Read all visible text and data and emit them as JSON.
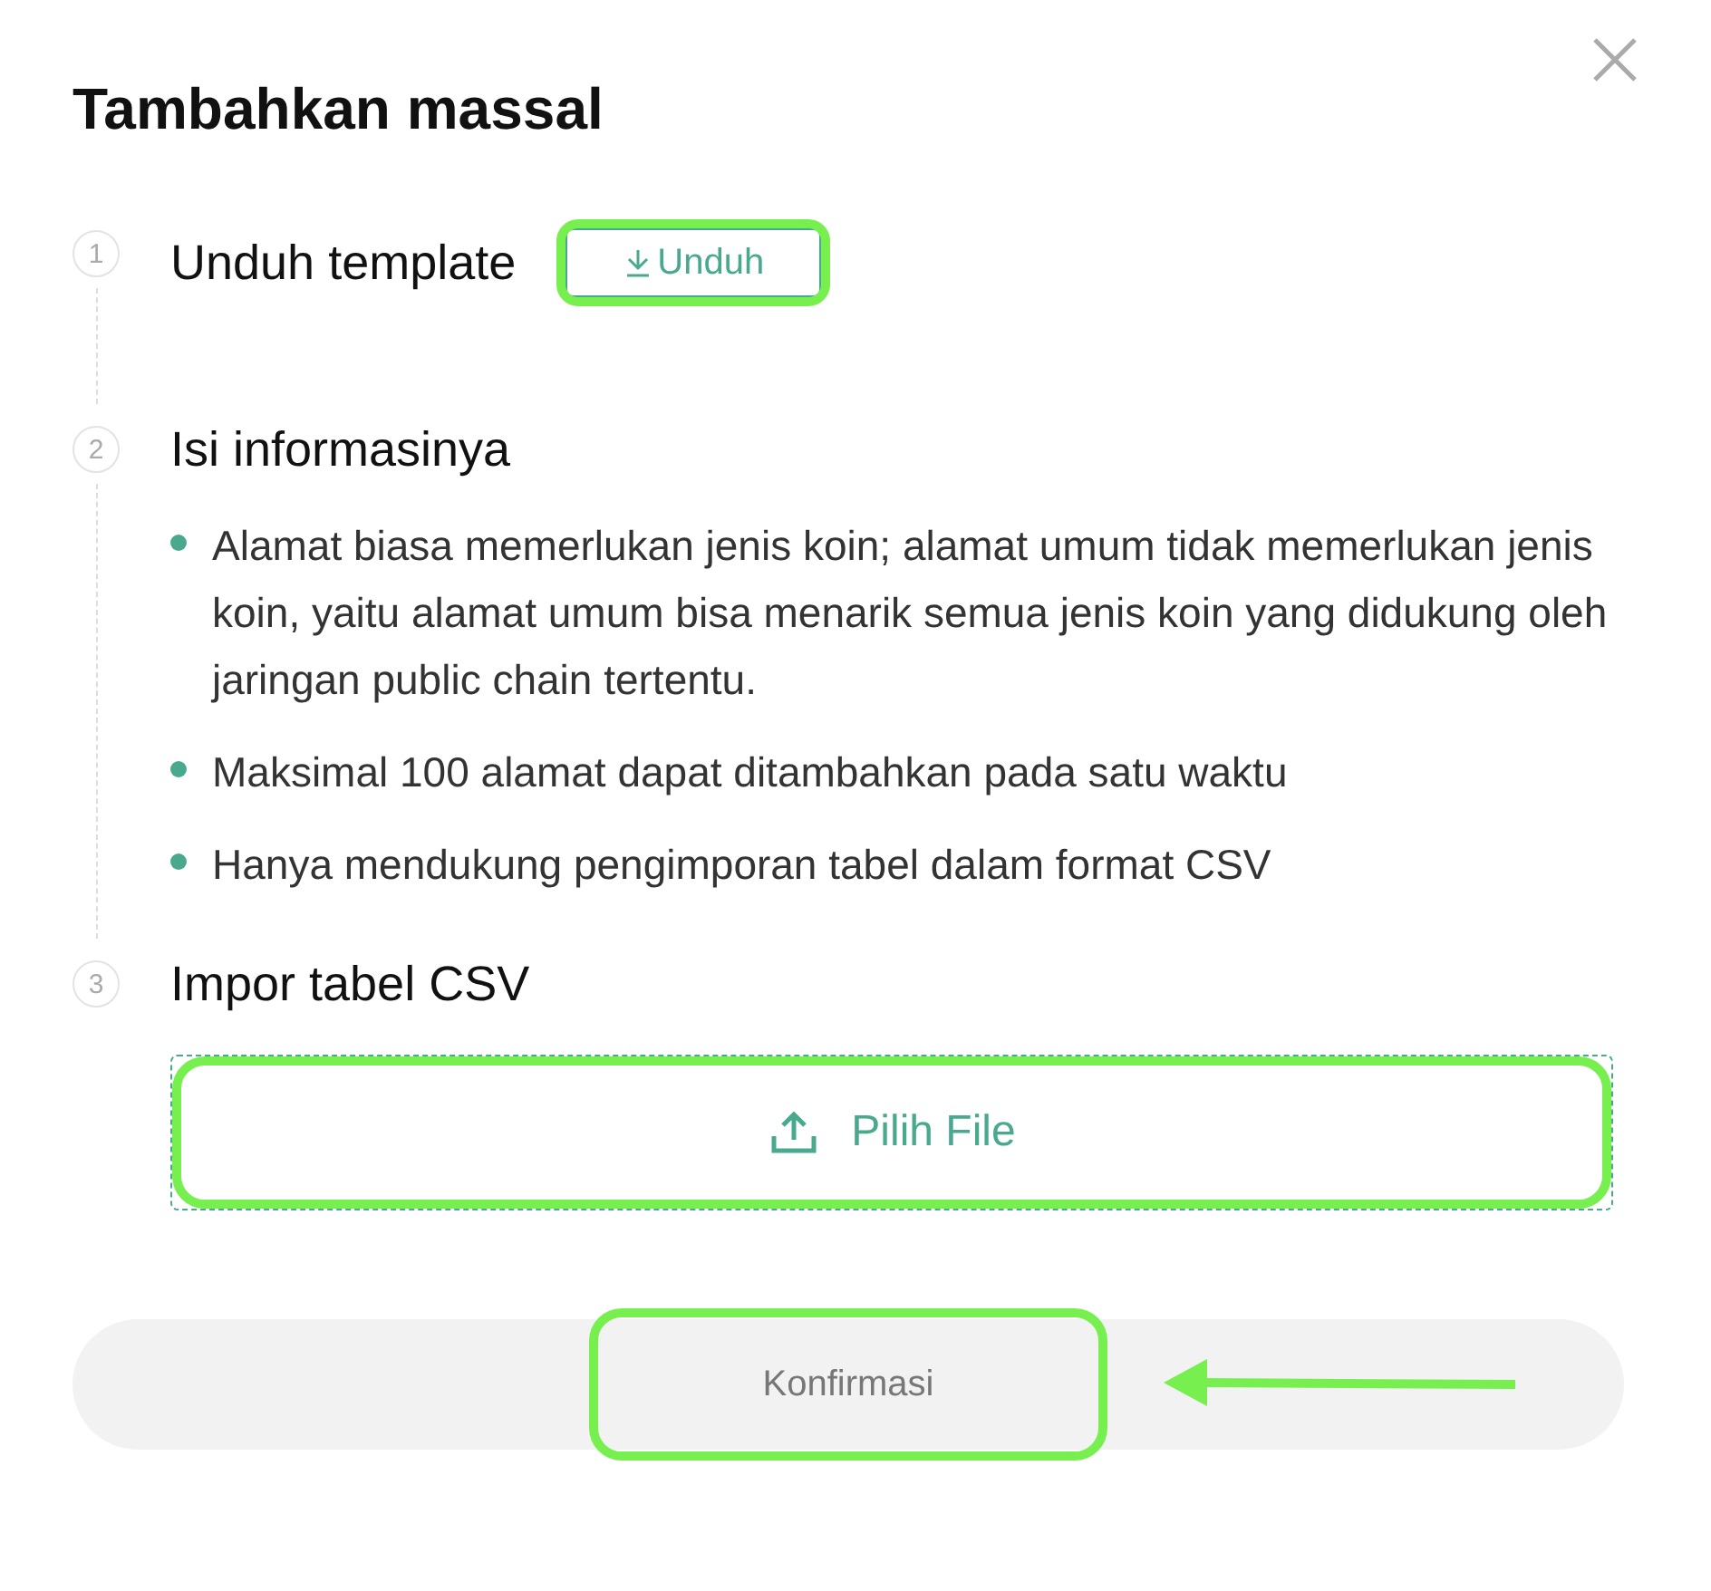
{
  "title": "Tambahkan massal",
  "steps": [
    {
      "number": "1",
      "label": "Unduh template",
      "kind": "download",
      "button": {
        "label": "Unduh",
        "highlighted": true
      }
    },
    {
      "number": "2",
      "label": "Isi informasinya",
      "kind": "bullets",
      "bullets": [
        "Alamat biasa memerlukan jenis koin; alamat umum tidak memerlukan jenis koin, yaitu alamat umum bisa menarik semua jenis koin yang didukung oleh jaringan public chain tertentu.",
        "Maksimal 100 alamat dapat ditambahkan pada satu waktu",
        "Hanya mendukung pengimporan tabel dalam format CSV"
      ]
    },
    {
      "number": "3",
      "label": "Impor tabel CSV",
      "kind": "upload",
      "button": {
        "label": "Pilih File",
        "highlighted": true
      }
    }
  ],
  "confirm": {
    "label": "Konfirmasi",
    "disabled": true,
    "highlighted": true,
    "pointer_arrow": true
  }
}
